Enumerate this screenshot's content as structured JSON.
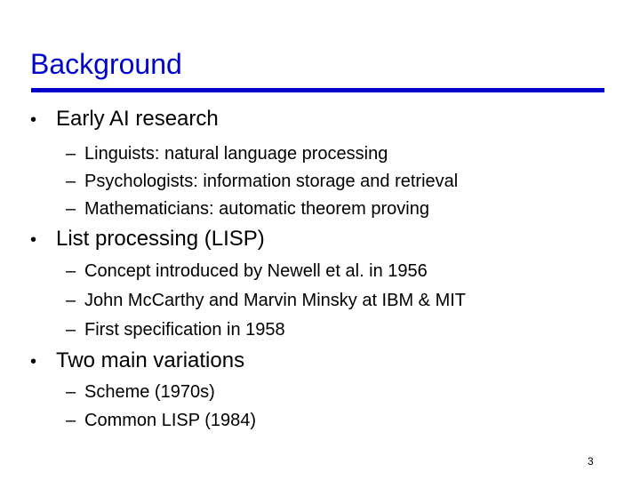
{
  "slide": {
    "title": "Background",
    "title_color": "#0000cc",
    "page_number": "3",
    "bullet_glyph": "•",
    "dash_glyph": "–",
    "sections": [
      {
        "text": "Early AI research",
        "items": [
          "Linguists: natural language processing",
          "Psychologists: information storage and retrieval",
          "Mathematicians: automatic theorem proving"
        ]
      },
      {
        "text": "List processing (LISP)",
        "items": [
          "Concept introduced by Newell et al. in 1956",
          "John McCarthy and Marvin Minsky at IBM & MIT",
          "First specification in 1958"
        ]
      },
      {
        "text": "Two main variations",
        "items": [
          "Scheme (1970s)",
          "Common LISP (1984)"
        ]
      }
    ]
  }
}
